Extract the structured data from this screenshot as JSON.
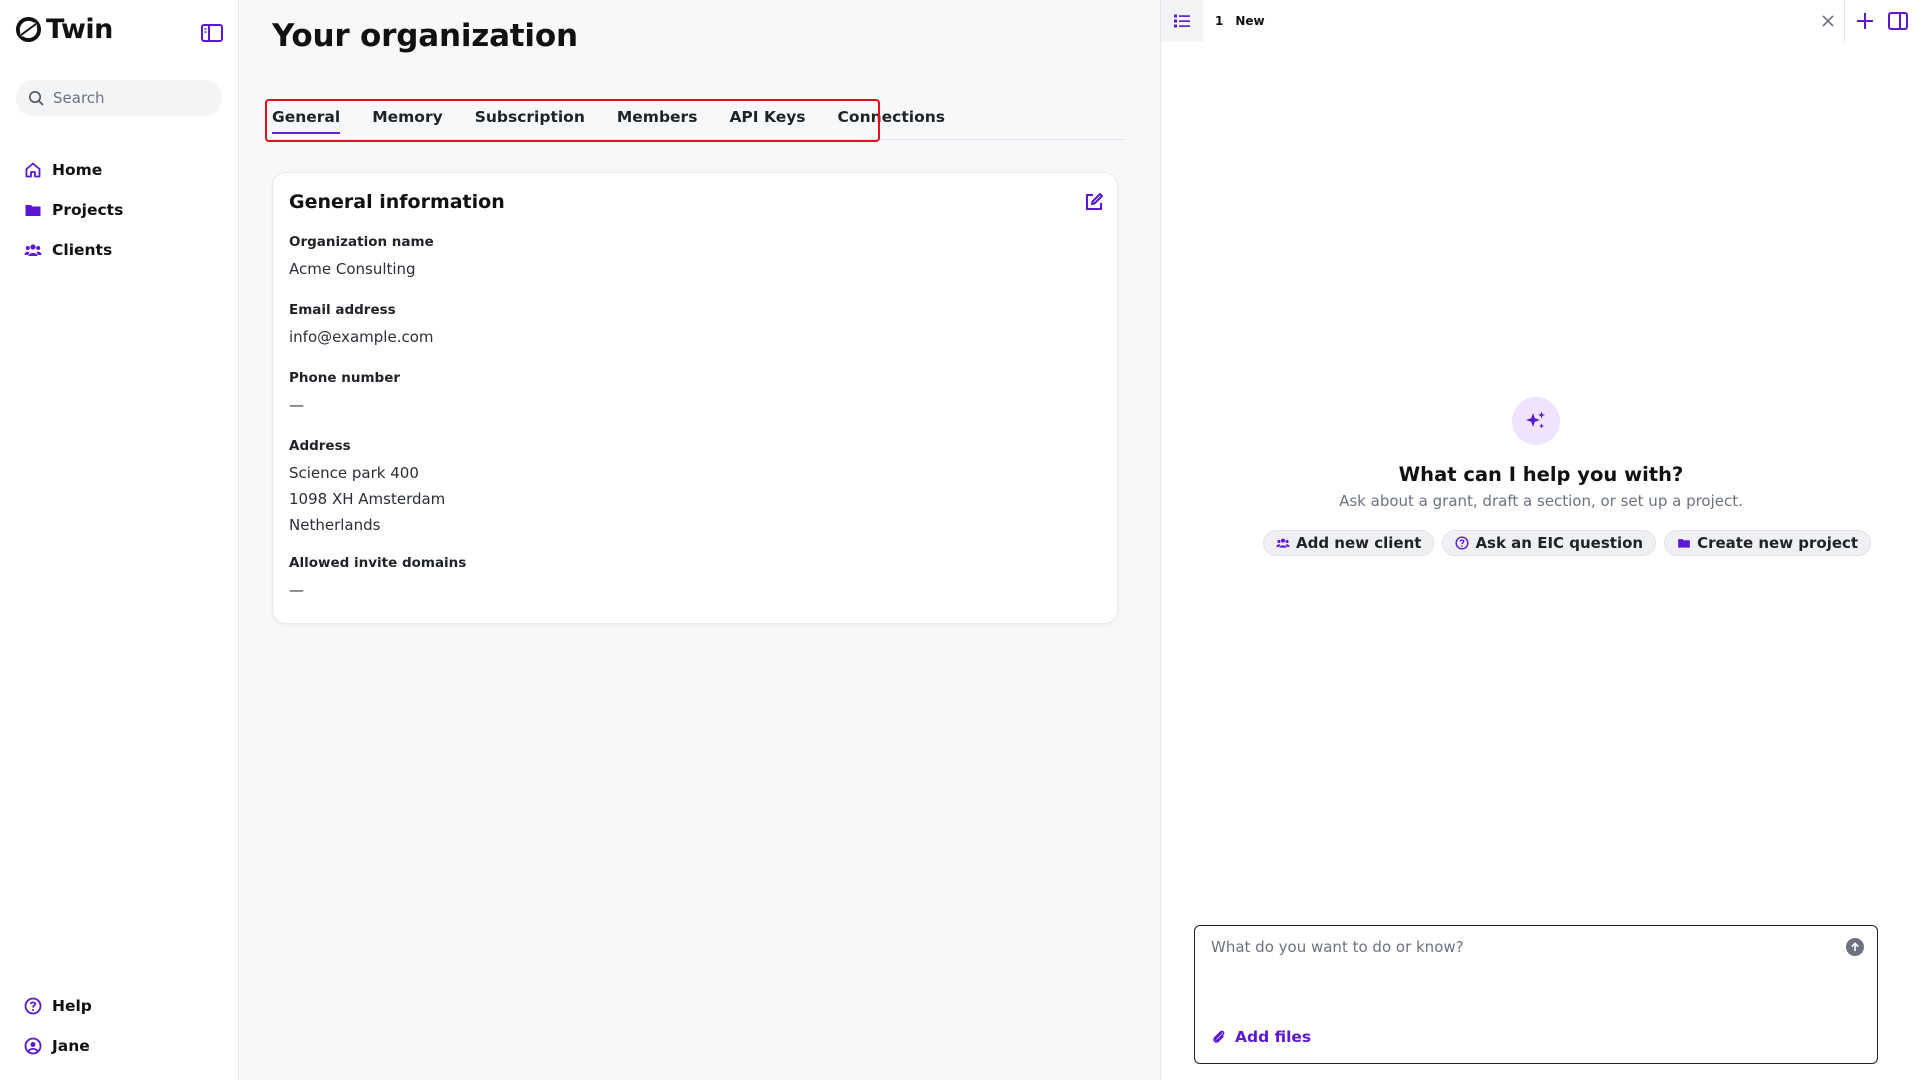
{
  "app": {
    "name": "Twin"
  },
  "colors": {
    "accent": "#6a1fd6",
    "highlight": "#e0101a"
  },
  "sidebar": {
    "search_placeholder": "Search",
    "items": [
      {
        "label": "Home",
        "icon": "home-icon"
      },
      {
        "label": "Projects",
        "icon": "folder-icon"
      },
      {
        "label": "Clients",
        "icon": "users-icon"
      }
    ],
    "bottom": [
      {
        "label": "Help",
        "icon": "help-icon"
      },
      {
        "label": "Jane",
        "icon": "user-icon"
      }
    ]
  },
  "main": {
    "title": "Your organization",
    "tabs": [
      {
        "label": "General",
        "active": true
      },
      {
        "label": "Memory"
      },
      {
        "label": "Subscription"
      },
      {
        "label": "Members"
      },
      {
        "label": "API Keys"
      },
      {
        "label": "Connections"
      }
    ],
    "card": {
      "title": "General information",
      "fields": {
        "org_name": {
          "label": "Organization name",
          "value": "Acme Consulting"
        },
        "email": {
          "label": "Email address",
          "value": "info@example.com"
        },
        "phone": {
          "label": "Phone number",
          "value": "—"
        },
        "address": {
          "label": "Address",
          "lines": [
            "Science park 400",
            "1098 XH Amsterdam",
            "Netherlands"
          ]
        },
        "domains": {
          "label": "Allowed invite domains",
          "value": "—"
        }
      }
    }
  },
  "panel": {
    "tab": {
      "index": "1",
      "label": "New"
    },
    "heading": "What can I help you with?",
    "subheading": "Ask about a grant, draft a section, or set up a project.",
    "chips": [
      {
        "label": "Add new client",
        "icon": "users-icon"
      },
      {
        "label": "Ask an EIC question",
        "icon": "question-icon"
      },
      {
        "label": "Create new project",
        "icon": "folder-icon"
      }
    ],
    "composer": {
      "placeholder": "What do you want to do or know?",
      "add_files_label": "Add files"
    }
  }
}
